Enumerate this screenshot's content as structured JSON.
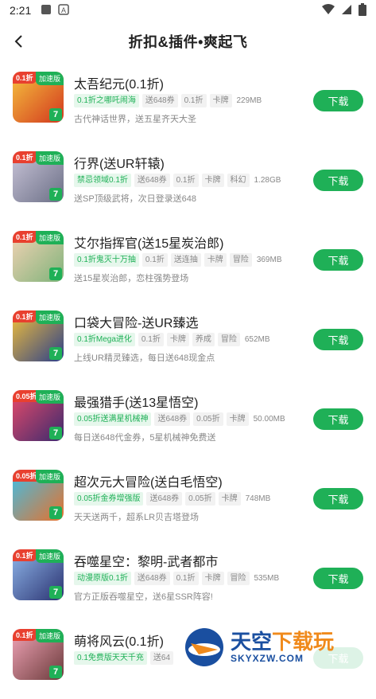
{
  "status": {
    "time": "2:21"
  },
  "header": {
    "title": "折扣&插件•爽起飞"
  },
  "items": [
    {
      "name": "太吾纪元(0.1折)",
      "discount": "0.1折",
      "speed": "加速版",
      "tags": [
        "0.1折之哪吒闹海",
        "送648券",
        "0.1折",
        "卡牌"
      ],
      "size": "229MB",
      "desc": "古代神话世界，送五星齐天大圣",
      "btn": "下载",
      "c1": "#f6c23e",
      "c2": "#d2371e"
    },
    {
      "name": "行界(送UR轩辕)",
      "discount": "0.1折",
      "speed": "加速版",
      "tags": [
        "禁忌领域0.1折",
        "送648券",
        "0.1折",
        "卡牌",
        "科幻"
      ],
      "size": "1.28GB",
      "desc": "送SP顶级武将，次日登录送648",
      "btn": "下载",
      "c1": "#c9c4d8",
      "c2": "#6b6f86"
    },
    {
      "name": "艾尔指挥官(送15星炭治郎)",
      "discount": "0.1折",
      "speed": "加速版",
      "tags": [
        "0.1折鬼灭十万抽",
        "0.1折",
        "送连抽",
        "卡牌",
        "冒险"
      ],
      "size": "369MB",
      "desc": "送15星炭治郎，恋柱强势登场",
      "btn": "下载",
      "c1": "#f4d3b5",
      "c2": "#7fb37a"
    },
    {
      "name": "口袋大冒险-送UR臻选",
      "discount": "0.1折",
      "speed": "加速版",
      "tags": [
        "0.1折Mega进化",
        "0.1折",
        "卡牌",
        "养成",
        "冒险"
      ],
      "size": "652MB",
      "desc": "上线UR精灵臻选，每日送648现金点",
      "btn": "下载",
      "c1": "#f4c13a",
      "c2": "#2b3f8a"
    },
    {
      "name": "最强猎手(送13星悟空)",
      "discount": "0.05折",
      "speed": "加速版",
      "tags": [
        "0.05折送满星机械神",
        "送648券",
        "0.05折",
        "卡牌"
      ],
      "size": "50.00MB",
      "desc": "每日送648代金券，5星机械神免费送",
      "btn": "下载",
      "c1": "#e94b6a",
      "c2": "#3a2a6e"
    },
    {
      "name": "超次元大冒险(送白毛悟空)",
      "discount": "0.05折",
      "speed": "加速版",
      "tags": [
        "0.05折金券增强版",
        "送648券",
        "0.05折",
        "卡牌"
      ],
      "size": "748MB",
      "desc": "天天送两千，超系LR贝吉塔登场",
      "btn": "下载",
      "c1": "#3ec0e8",
      "c2": "#e8702a"
    },
    {
      "name": "吞噬星空：黎明-武者都市",
      "discount": "0.1折",
      "speed": "加速版",
      "tags": [
        "动漫原版0.1折",
        "送648券",
        "0.1折",
        "卡牌",
        "冒险"
      ],
      "size": "535MB",
      "desc": "官方正版吞噬星空，送6星SSR阵容!",
      "btn": "下载",
      "c1": "#8fb6ea",
      "c2": "#2a3270"
    },
    {
      "name": "萌将风云(0.1折)",
      "discount": "0.1折",
      "speed": "加速版",
      "tags": [
        "0.1免费版天天千充",
        "送64"
      ],
      "size": "",
      "desc": "",
      "btn": "下载",
      "c1": "#f2a5b8",
      "c2": "#6a3a3a"
    }
  ],
  "watermark": {
    "cn1": "天空",
    "cn2": "下载玩",
    "en": "SKYXZW.COM"
  }
}
